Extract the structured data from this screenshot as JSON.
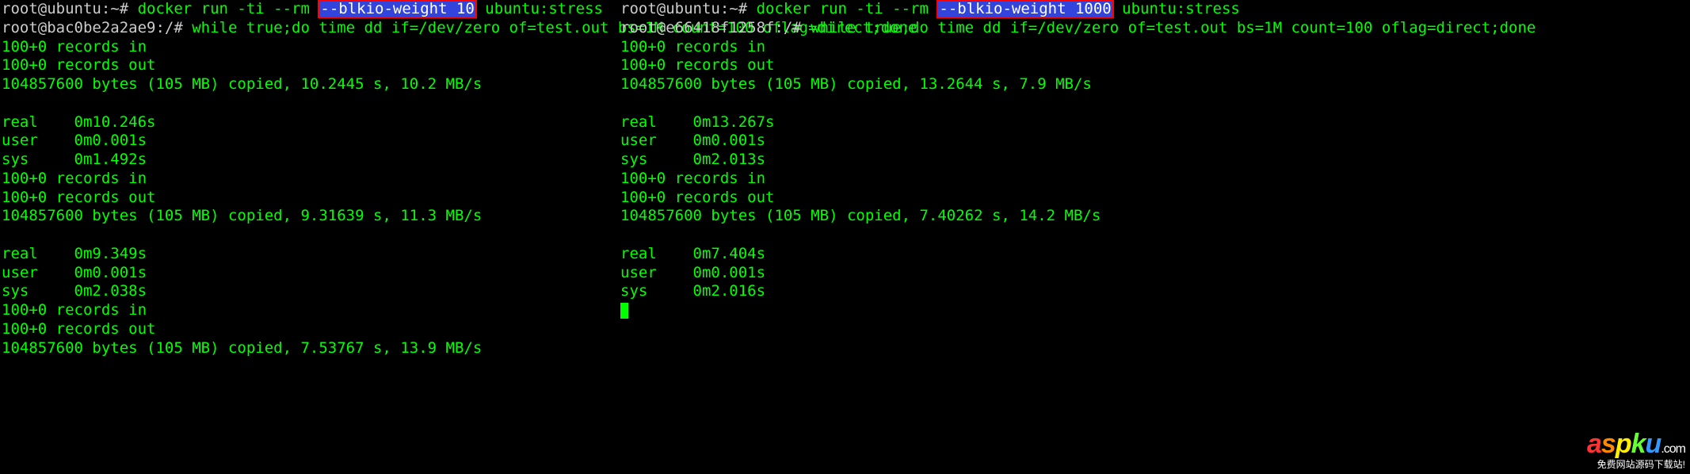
{
  "left": {
    "prompt1_prefix": "root@ubuntu:~# ",
    "cmd1_before": "docker run -ti --rm ",
    "cmd1_highlight": "--blkio-weight 10",
    "cmd1_after": " ubuntu:stress",
    "prompt2_prefix": "root@bac0be2a2ae9:/# ",
    "cmd2": "while true;do time dd if=/dev/zero of=test.out bs=1M count=100 oflag=direct;done",
    "block1": {
      "records_in": "100+0 records in",
      "records_out": "100+0 records out",
      "bytes": "104857600 bytes (105 MB) copied, 10.2445 s, 10.2 MB/s",
      "real": "real    0m10.246s",
      "user": "user    0m0.001s",
      "sys": "sys     0m1.492s"
    },
    "block2": {
      "records_in": "100+0 records in",
      "records_out": "100+0 records out",
      "bytes": "104857600 bytes (105 MB) copied, 9.31639 s, 11.3 MB/s",
      "real": "real    0m9.349s",
      "user": "user    0m0.001s",
      "sys": "sys     0m2.038s"
    },
    "block3": {
      "records_in": "100+0 records in",
      "records_out": "100+0 records out",
      "bytes": "104857600 bytes (105 MB) copied, 7.53767 s, 13.9 MB/s"
    }
  },
  "right": {
    "prompt1_prefix": "root@ubuntu:~# ",
    "cmd1_before": "docker run -ti --rm ",
    "cmd1_highlight": "--blkio-weight 1000",
    "cmd1_after": " ubuntu:stress",
    "prompt2_prefix": "root@e66418f1258f:/# ",
    "cmd2": "while true;do time dd if=/dev/zero of=test.out bs=1M count=100 oflag=direct;done",
    "block1": {
      "records_in": "100+0 records in",
      "records_out": "100+0 records out",
      "bytes": "104857600 bytes (105 MB) copied, 13.2644 s, 7.9 MB/s",
      "real": "real    0m13.267s",
      "user": "user    0m0.001s",
      "sys": "sys     0m2.013s"
    },
    "block2": {
      "records_in": "100+0 records in",
      "records_out": "100+0 records out",
      "bytes": "104857600 bytes (105 MB) copied, 7.40262 s, 14.2 MB/s",
      "real": "real    0m7.404s",
      "user": "user    0m0.001s",
      "sys": "sys     0m2.016s"
    }
  },
  "watermark": {
    "brand_a": "a",
    "brand_s": "s",
    "brand_p": "p",
    "brand_k": "k",
    "brand_u": "u",
    "brand_dotcom": ".com",
    "sub": "免费网站源码下载站!"
  }
}
